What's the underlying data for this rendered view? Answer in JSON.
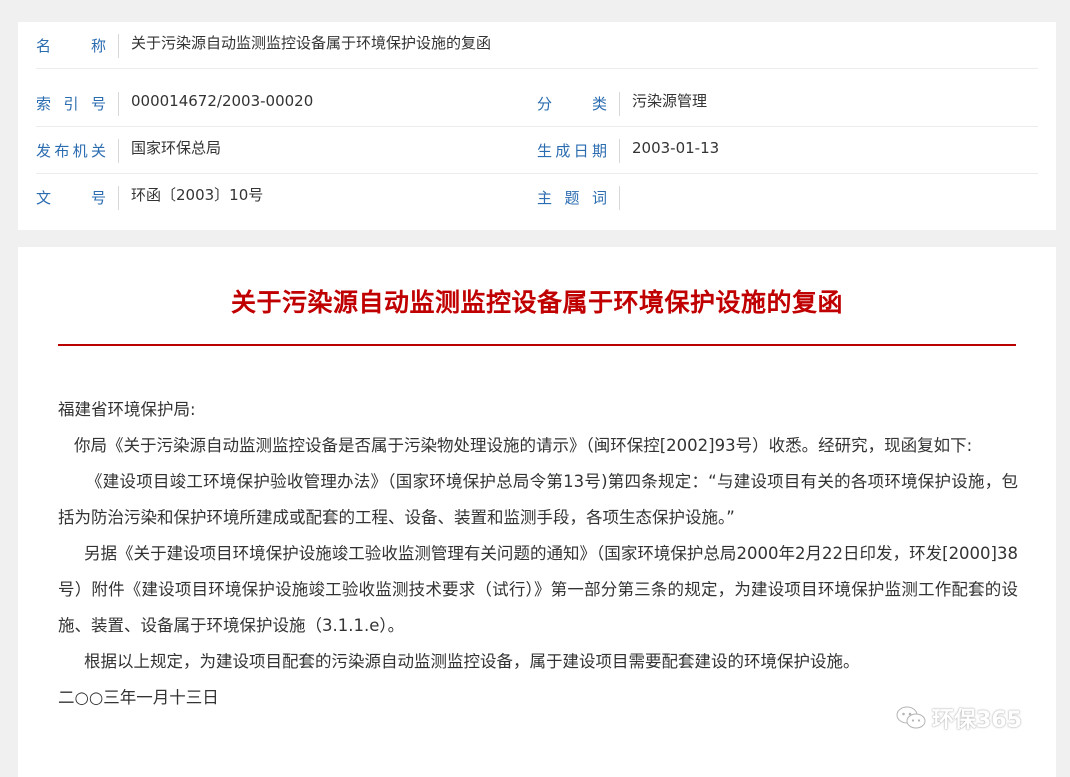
{
  "meta": {
    "name_label": "名 称",
    "name_value": "关于污染源自动监测监控设备属于环境保护设施的复函",
    "index_label": "索 引 号",
    "index_value": "000014672/2003-00020",
    "category_label": "分 类",
    "category_value": "污染源管理",
    "issuer_label": "发布机关",
    "issuer_value": "国家环保总局",
    "date_label": "生成日期",
    "date_value": "2003-01-13",
    "docno_label": "文 号",
    "docno_value": "环函〔2003〕10号",
    "subject_label": "主 题 词",
    "subject_value": ""
  },
  "document": {
    "title": "关于污染源自动监测监控设备属于环境保护设施的复函",
    "salutation": "福建省环境保护局:",
    "paragraphs": [
      "你局《关于污染源自动监测监控设备是否属于污染物处理设施的请示》（闽环保控[2002]93号）收悉。经研究，现函复如下:",
      "《建设项目竣工环境保护验收管理办法》（国家环境保护总局令第13号)第四条规定：“与建设项目有关的各项环境保护设施，包括为防治污染和保护环境所建成或配套的工程、设备、装置和监测手段，各项生态保护设施。”",
      "另据《关于建设项目环境保护设施竣工验收监测管理有关问题的通知》（国家环境保护总局2000年2月22日印发，环发[2000]38号）附件《建设项目环境保护设施竣工验收监测技术要求（试行）》第一部分第三条的规定，为建设项目环境保护监测工作配套的设施、装置、设备属于环境保护设施（3.1.1.e）。",
      "根据以上规定，为建设项目配套的污染源自动监测监控设备，属于建设项目需要配套建设的环境保护设施。"
    ],
    "date": "二○○三年一月十三日"
  },
  "watermark": {
    "text": "环保365",
    "icon": "wechat-icon"
  }
}
